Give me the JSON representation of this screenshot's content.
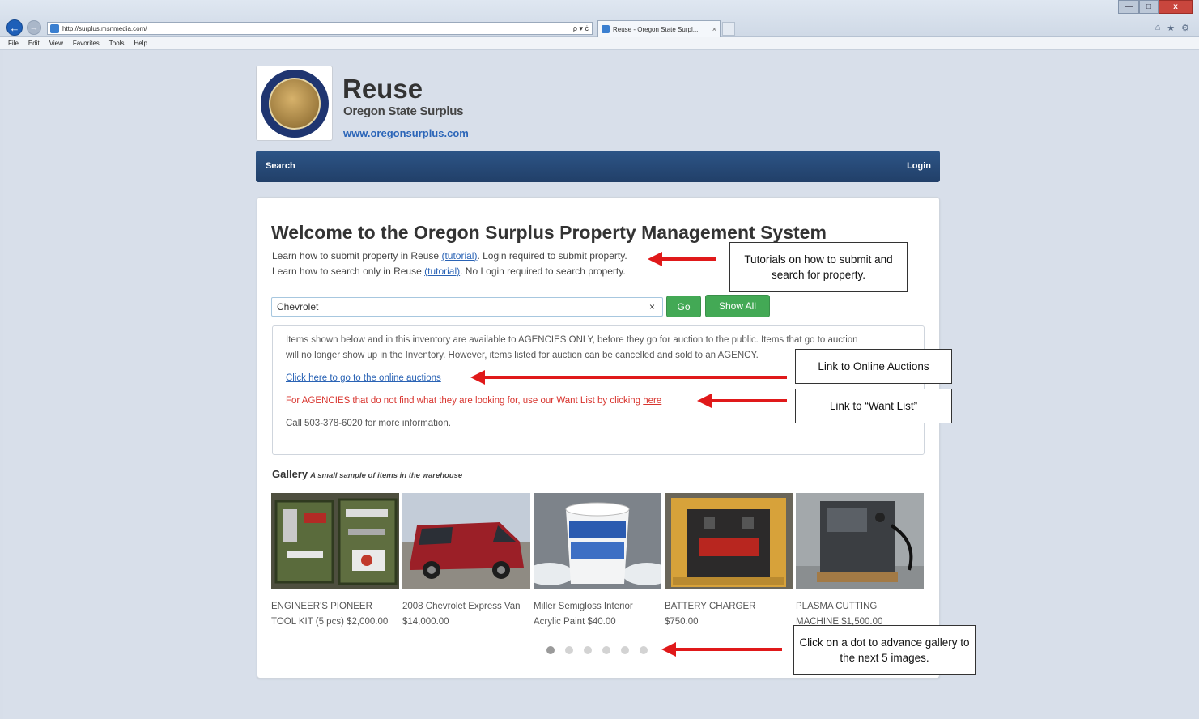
{
  "browser": {
    "url": "http://surplus.msnmedia.com/",
    "search_tools": "ρ ▾ ċ",
    "tab_title": "Reuse - Oregon State Surpl...",
    "tab_close": "×",
    "window_min": "—",
    "window_max": "□",
    "window_close": "x",
    "icon_home": "⌂",
    "icon_star": "★",
    "icon_gear": "⚙",
    "back_icon": "←",
    "forward_icon": "→",
    "menu": [
      "File",
      "Edit",
      "View",
      "Favorites",
      "Tools",
      "Help"
    ]
  },
  "header": {
    "title": "Reuse",
    "subtitle": "Oregon State Surplus",
    "url": "www.oregonsurplus.com"
  },
  "navbar": {
    "search": "Search",
    "login": "Login"
  },
  "main": {
    "welcome": "Welcome to the Oregon Surplus Property Management System",
    "learn_submit": {
      "before": "Learn how to submit property in Reuse ",
      "link": "(tutorial)",
      "after": ". Login required to submit property."
    },
    "learn_search": {
      "before": "Learn how to search only in Reuse ",
      "link": "(tutorial)",
      "after": ". No Login required to search property."
    },
    "search": {
      "value": "Chevrolet",
      "clear": "×",
      "go": "Go",
      "show_all": "Show All"
    },
    "notice": {
      "line1": "Items shown below and in this inventory are available to AGENCIES ONLY, before they go for auction to the public. Items that go to auction",
      "line2": "will no longer show up in the Inventory. However, items listed for auction can be cancelled and sold to an AGENCY.",
      "auction_link": "Click here to go to the online auctions",
      "want_text": "For AGENCIES that do not find what they are looking for, use our Want List by clicking ",
      "want_link": "here",
      "call": "Call 503-378-6020 for more information."
    },
    "gallery": {
      "title": "Gallery",
      "subtitle": "A small sample of items in the warehouse",
      "items": [
        {
          "line1": "ENGINEER'S PIONEER",
          "line2": "TOOL KIT (5 pcs)  $2,000.00"
        },
        {
          "line1": "2008 Chevrolet Express Van",
          "line2": "$14,000.00"
        },
        {
          "line1": "Miller Semigloss Interior",
          "line2": "Acrylic Paint  $40.00"
        },
        {
          "line1": "BATTERY CHARGER",
          "line2": "$750.00"
        },
        {
          "line1": "PLASMA CUTTING",
          "line2": "MACHINE  $1,500.00"
        }
      ],
      "dots": 6,
      "active_dot": 1
    }
  },
  "annotations": {
    "tutorials": "Tutorials on how to submit and search for property.",
    "auctions": "Link to Online Auctions",
    "want_list": "Link to “Want List”",
    "gallery_dots": "Click on a dot to advance gallery to the next 5 images.",
    "arrow_color": "#e0191a"
  }
}
